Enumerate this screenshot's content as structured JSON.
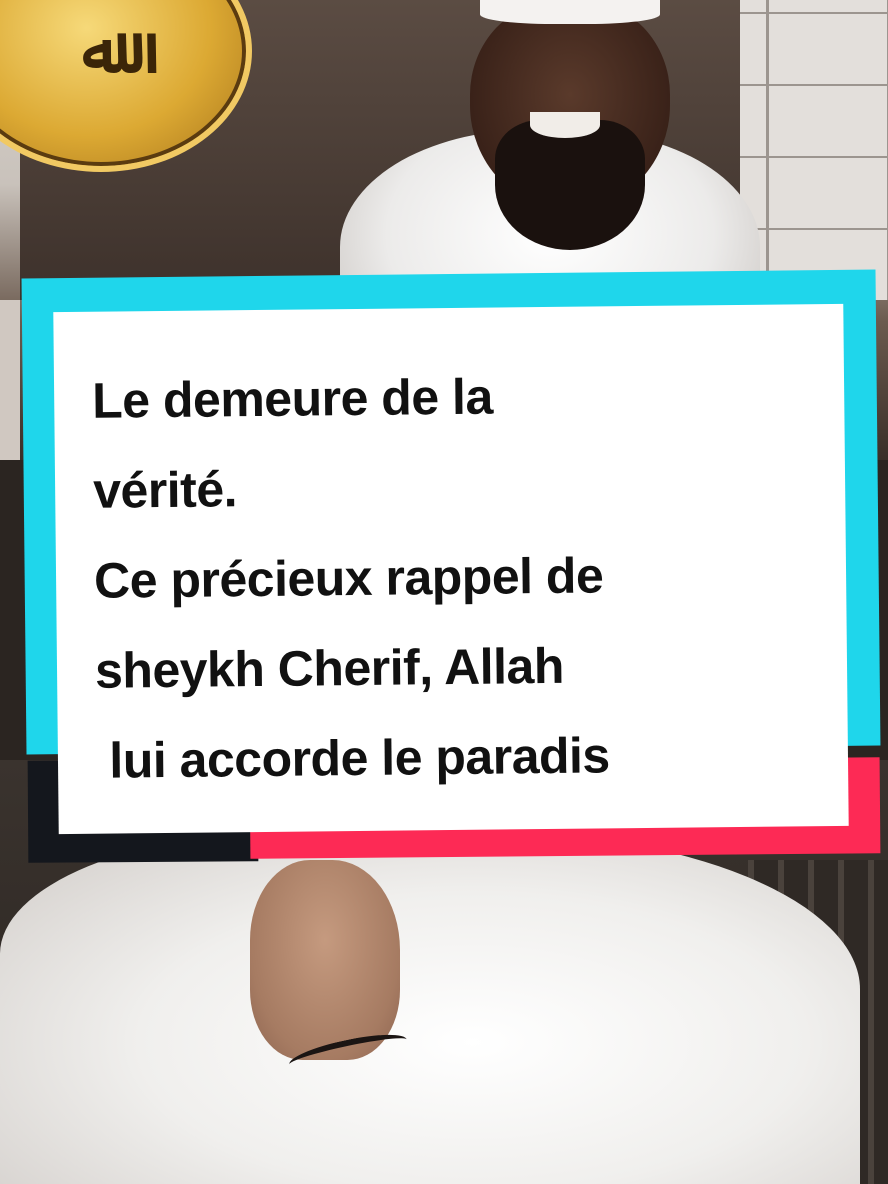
{
  "logo": {
    "text": "ﷲ",
    "icon": "allah-calligraphy-logo",
    "colors": {
      "gold": "#dca933",
      "dark": "#3b2508"
    }
  },
  "caption": {
    "lines": [
      "Le demeure de la",
      "vérité.",
      "Ce précieux rappel de",
      "sheykh Cherif, Allah",
      " lui accorde le paradis"
    ]
  },
  "colors": {
    "cyan_card": "#1fd6eb",
    "red_card": "#fd2a55",
    "black_card": "#14171d",
    "white_card": "#ffffff",
    "text": "#111111"
  }
}
